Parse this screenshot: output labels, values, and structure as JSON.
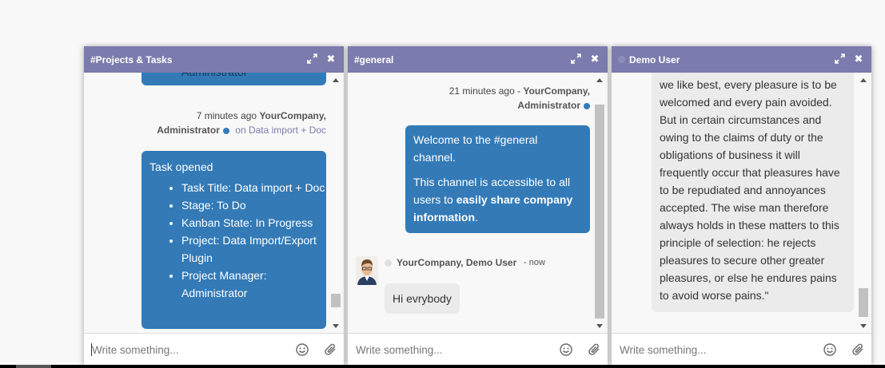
{
  "chats": [
    {
      "title": "#Projects & Tasks",
      "partial_top_text": "Administrator",
      "meta": {
        "time": "7 minutes ago",
        "author_line1": "YourCompany,",
        "author_line2": "Administrator",
        "link": "on Data import + Doc"
      },
      "message": {
        "heading": "Task opened",
        "items": [
          "Task Title: Data import + Doc",
          "Stage: To Do",
          "Kanban State: In Progress",
          "Project: Data Import/Export Plugin",
          "Project Manager: Administrator"
        ]
      },
      "composer_placeholder": "Write something..."
    },
    {
      "title": "#general",
      "meta": {
        "time": "21 minutes ago - ",
        "author_line1": "YourCompany,",
        "author_line2": "Administrator"
      },
      "message": {
        "p1": "Welcome to the #general channel.",
        "p2_before": "This channel is accessible to all users to ",
        "p2_bold": "easily share company information",
        "p2_after": "."
      },
      "reply": {
        "author": "YourCompany, Demo User",
        "time": "- now",
        "text": "Hi evrybody"
      },
      "composer_placeholder": "Write something..."
    },
    {
      "title": "Demo User",
      "message_lines": [
        "we like best, every pleasure is to be",
        "welcomed and every pain avoided.",
        "But in certain circumstances and",
        "owing to the claims of duty or the",
        "obligations of business it will",
        "frequently occur that pleasures have",
        "to be repudiated and annoyances",
        "accepted. The wise man therefore",
        "always holds in these matters to this",
        "principle of selection: he rejects",
        "pleasures to secure other greater",
        "pleasures, or else he endures pains",
        "to avoid worse pains.\""
      ],
      "composer_placeholder": "Write something..."
    }
  ],
  "colors": {
    "header": "#7c7bad",
    "bubble": "#337ab7",
    "bubble_grey": "#ebebeb"
  },
  "icons": {
    "expand": "expand-icon",
    "close": "close-icon",
    "emoji": "smiley-icon",
    "attach": "paperclip-icon"
  }
}
